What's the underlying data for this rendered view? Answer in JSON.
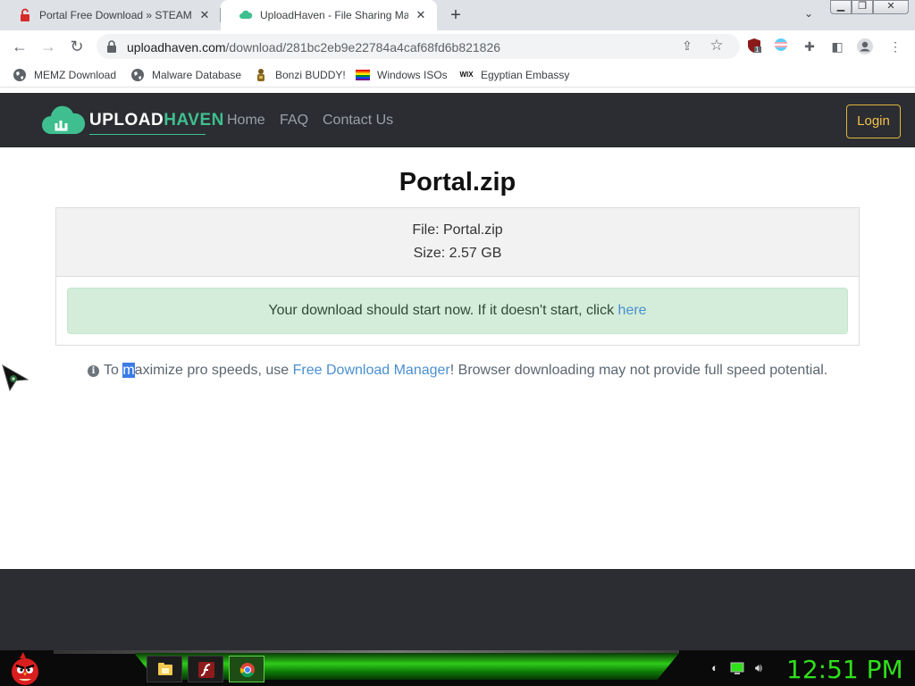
{
  "browser": {
    "tabs": [
      {
        "title": "Portal Free Download » STEAMUNLOCKED",
        "active": false
      },
      {
        "title": "UploadHaven - File Sharing Made Simple",
        "active": true
      }
    ],
    "new_tab_label": "+",
    "url_host": "uploadhaven.com",
    "url_path": "/download/281bc2eb9e22784a4caf68fd6b821826",
    "extension_badge": "1",
    "bookmarks": [
      {
        "label": "MEMZ Download",
        "icon": "globe-icon"
      },
      {
        "label": "Malware Database",
        "icon": "globe-icon"
      },
      {
        "label": "Bonzi BUDDY!",
        "icon": "bonzi-icon"
      },
      {
        "label": "Windows ISOs",
        "icon": "rainbow-flag-icon"
      },
      {
        "label": "Egyptian Embassy",
        "icon": "wix-icon"
      }
    ],
    "wix_glyph": "WIX"
  },
  "site": {
    "logo_upload": "UPLOAD",
    "logo_haven": "HAVEN",
    "nav": [
      "Home",
      "FAQ",
      "Contact Us"
    ],
    "login_label": "Login",
    "accent_color": "#3fbf8f",
    "login_color": "#e0b53a"
  },
  "download": {
    "title": "Portal.zip",
    "file_line": "File: Portal.zip",
    "size_line": "Size: 2.57 GB",
    "alert_text": "Your download should start now. If it doesn't start, click ",
    "alert_link": "here"
  },
  "tip": {
    "icon_glyph": "i",
    "before_selection": "To ",
    "selected_text": "m",
    "after_selection": "aximize pro speeds, use ",
    "link_text": "Free Download Manager",
    "suffix": "! Browser downloading may not provide full speed potential."
  },
  "taskbar": {
    "clock": "12:51 PM",
    "apps": [
      "file-explorer-icon",
      "flash-icon",
      "chrome-icon"
    ],
    "active_app": "chrome-icon"
  }
}
